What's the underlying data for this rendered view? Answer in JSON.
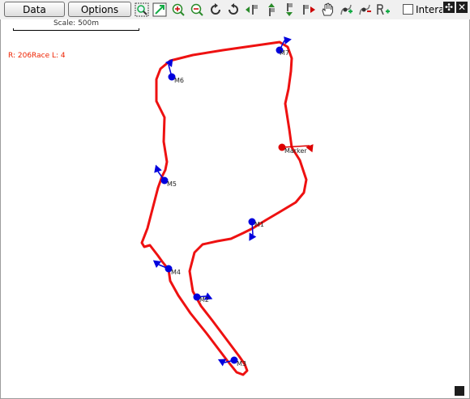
{
  "toolbar": {
    "data_label": "Data",
    "options_label": "Options",
    "interact_label": "Interact",
    "tools": [
      {
        "name": "zoom-region-icon"
      },
      {
        "name": "zoom-extent-icon"
      },
      {
        "name": "zoom-in-icon"
      },
      {
        "name": "zoom-out-icon"
      },
      {
        "name": "rotate-right-icon"
      },
      {
        "name": "rotate-left-icon"
      },
      {
        "name": "previous-marker-icon"
      },
      {
        "name": "marker-up-icon"
      },
      {
        "name": "marker-down-icon"
      },
      {
        "name": "next-marker-icon"
      },
      {
        "name": "pan-hand-icon"
      },
      {
        "name": "add-marker-icon"
      },
      {
        "name": "remove-marker-icon"
      },
      {
        "name": "reset-markers-icon"
      }
    ]
  },
  "scale_label": "Scale: 500m",
  "session_info": "R: 206Race  L: 4",
  "track_color": "#ee1111",
  "marker_color": "#0000dd",
  "active_marker_color": "#dd0000",
  "markers": [
    {
      "label": "M1"
    },
    {
      "label": "M2"
    },
    {
      "label": "M3"
    },
    {
      "label": "M4"
    },
    {
      "label": "M5"
    },
    {
      "label": "M6"
    },
    {
      "label": "M7"
    },
    {
      "label": "Marker",
      "active": true
    }
  ]
}
